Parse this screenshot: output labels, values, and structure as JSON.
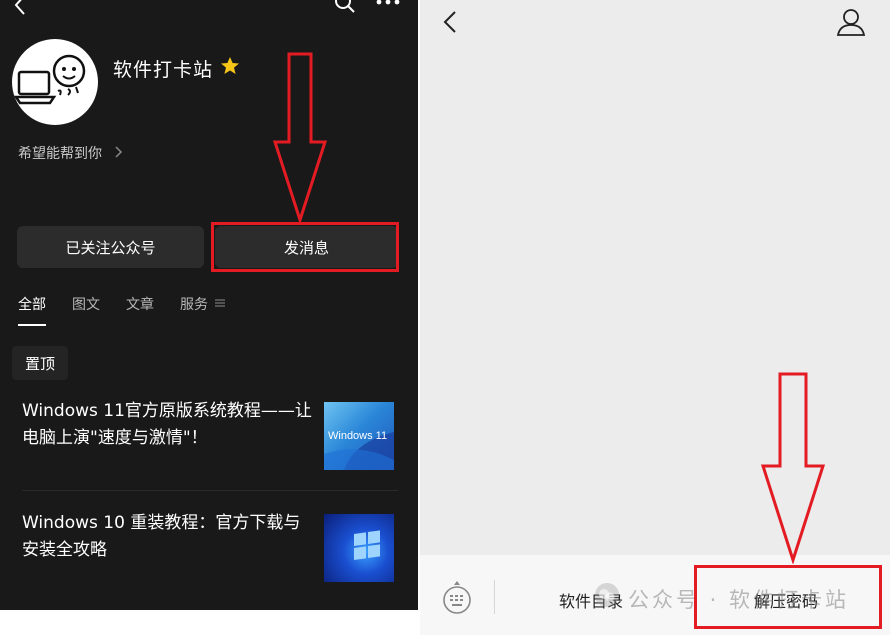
{
  "left": {
    "account_name": "软件打卡站",
    "description": "希望能帮到你",
    "btn_followed": "已关注公众号",
    "btn_message": "发消息",
    "tabs": [
      "全部",
      "图文",
      "文章",
      "服务"
    ],
    "pinned": "置顶",
    "articles": [
      {
        "title": "Windows 11官方原版系统教程——让电脑上演\"速度与激情\"！",
        "thumb_text": "Windows 11"
      },
      {
        "title": "Windows 10 重装教程：官方下载与安装全攻略",
        "thumb_text": ""
      }
    ]
  },
  "right": {
    "menu_catalog": "软件目录",
    "menu_unzip": "解压密码",
    "watermark": "公众号 · 软件打卡站"
  },
  "colors": {
    "dark_bg": "#191919",
    "chat_bg": "#ececec",
    "annotation_red": "#e31b23",
    "star": "#f5c518"
  },
  "icons": [
    "back-icon",
    "search-icon",
    "more-icon",
    "star-icon",
    "chevron-right-icon",
    "menu-icon",
    "profile-icon",
    "keyboard-icon"
  ]
}
